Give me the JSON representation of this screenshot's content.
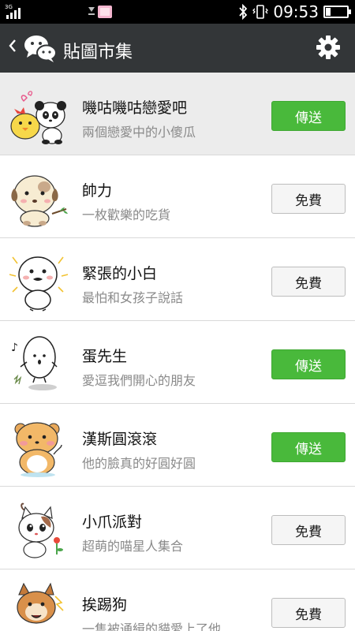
{
  "status_bar": {
    "network": "3G",
    "time": "09:53"
  },
  "header": {
    "back_icon": "chevron-left-icon",
    "title": "貼圖市集"
  },
  "stickers": [
    {
      "name": "嘰咕嘰咕戀愛吧",
      "desc": "兩個戀愛中的小傻瓜",
      "action": "傳送",
      "kind": "send"
    },
    {
      "name": "帥力",
      "desc": "一枚歡樂的吃貨",
      "action": "免費",
      "kind": "free"
    },
    {
      "name": "緊張的小白",
      "desc": "最怕和女孩子說話",
      "action": "免費",
      "kind": "free"
    },
    {
      "name": "蛋先生",
      "desc": "愛逗我們開心的朋友",
      "action": "傳送",
      "kind": "send"
    },
    {
      "name": "漢斯圓滾滾",
      "desc": "他的臉真的好圓好圓",
      "action": "傳送",
      "kind": "send"
    },
    {
      "name": "小爪派對",
      "desc": "超萌的喵星人集合",
      "action": "免費",
      "kind": "free"
    },
    {
      "name": "挨踢狗",
      "desc": "一隻被通緝的貓愛上了他",
      "action": "免費",
      "kind": "free"
    }
  ],
  "colors": {
    "header_bg": "#333638",
    "send_button": "#49b93b",
    "free_button": "#f5f5f5"
  }
}
